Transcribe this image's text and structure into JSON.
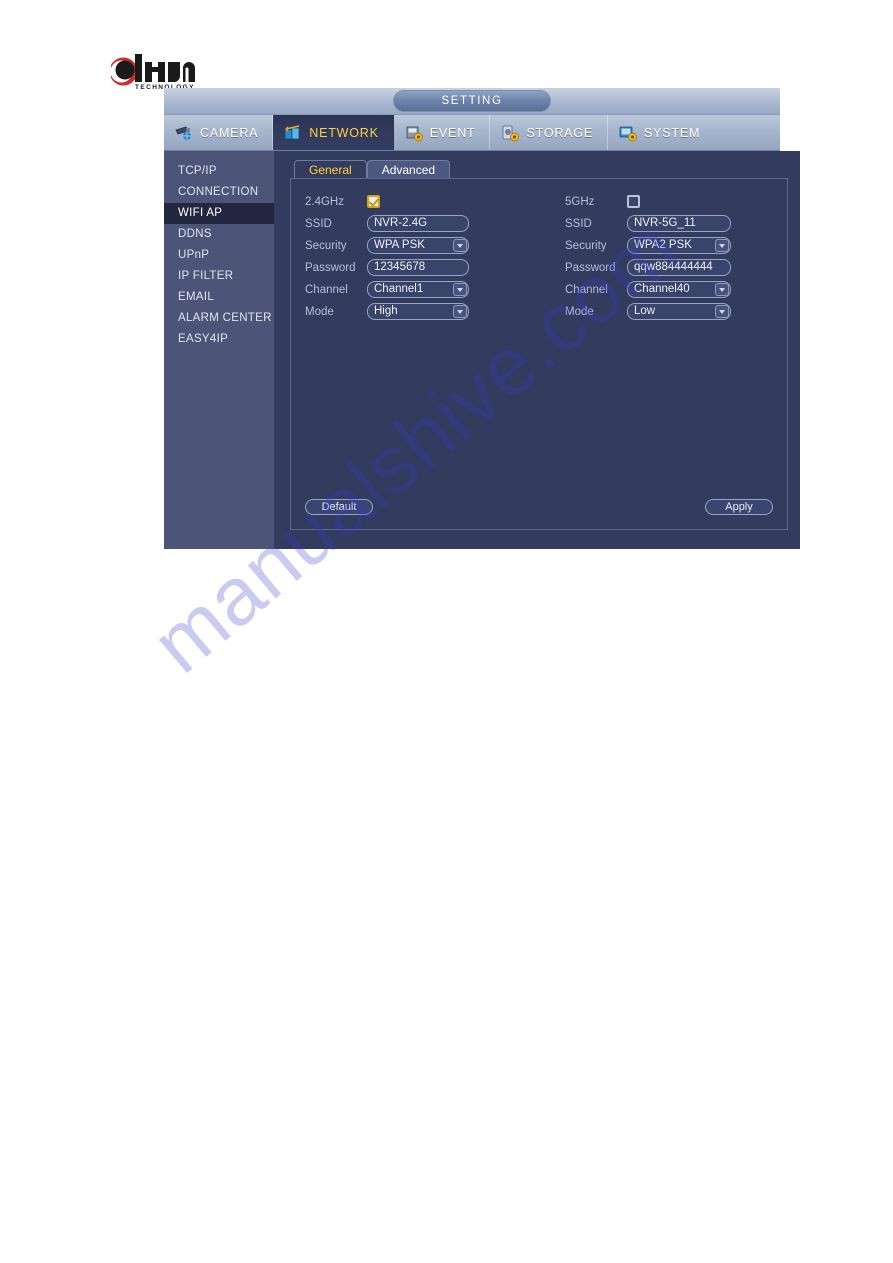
{
  "brand": {
    "name": "alhua",
    "tagline": "TECHNOLOGY"
  },
  "dialog": {
    "title": "SETTING",
    "tabs": [
      {
        "label": "CAMERA",
        "icon": "camera-icon",
        "active": false
      },
      {
        "label": "NETWORK",
        "icon": "network-icon",
        "active": true
      },
      {
        "label": "EVENT",
        "icon": "event-icon",
        "active": false
      },
      {
        "label": "STORAGE",
        "icon": "storage-icon",
        "active": false
      },
      {
        "label": "SYSTEM",
        "icon": "system-icon",
        "active": false
      }
    ],
    "sidebar": [
      {
        "label": "TCP/IP",
        "active": false
      },
      {
        "label": "CONNECTION",
        "active": false
      },
      {
        "label": "WIFI AP",
        "active": true
      },
      {
        "label": "DDNS",
        "active": false
      },
      {
        "label": "UPnP",
        "active": false
      },
      {
        "label": "IP FILTER",
        "active": false
      },
      {
        "label": "EMAIL",
        "active": false
      },
      {
        "label": "ALARM CENTER",
        "active": false
      },
      {
        "label": "EASY4IP",
        "active": false
      }
    ],
    "inner_tabs": [
      {
        "label": "General",
        "active": true
      },
      {
        "label": "Advanced",
        "active": false
      }
    ],
    "form": {
      "band_24": {
        "enable_label": "2.4GHz",
        "enabled": true,
        "ssid_label": "SSID",
        "ssid_value": "NVR-2.4G",
        "security_label": "Security",
        "security_value": "WPA PSK",
        "password_label": "Password",
        "password_value": "12345678",
        "channel_label": "Channel",
        "channel_value": "Channel1",
        "mode_label": "Mode",
        "mode_value": "High"
      },
      "band_5": {
        "enable_label": "5GHz",
        "enabled": false,
        "ssid_label": "SSID",
        "ssid_value": "NVR-5G_11",
        "security_label": "Security",
        "security_value": "WPA2 PSK",
        "password_label": "Password",
        "password_value": "qqw884444444",
        "channel_label": "Channel",
        "channel_value": "Channel40",
        "mode_label": "Mode",
        "mode_value": "Low"
      }
    },
    "buttons": {
      "default_label": "Default",
      "apply_label": "Apply"
    }
  },
  "watermark": {
    "text": "manualshive.com"
  },
  "colors": {
    "accent_yellow": "#ffd33a",
    "panel_bg": "#333b5e",
    "sidebar_bg": "#4c5578",
    "sidebar_active_bg": "#22273f",
    "header_bg": "#aab8d0"
  }
}
